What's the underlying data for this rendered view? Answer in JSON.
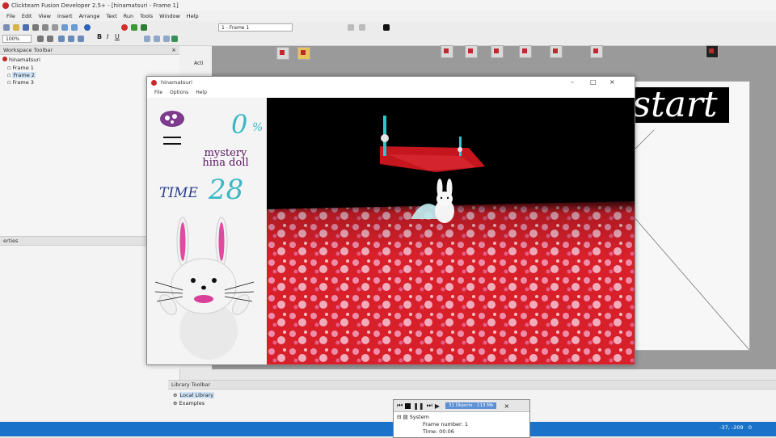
{
  "ide": {
    "title": "Clickteam Fusion Developer 2.5+ - [hinamatsuri - Frame 1]",
    "menu": [
      "File",
      "Edit",
      "View",
      "Insert",
      "Arrange",
      "Text",
      "Run",
      "Tools",
      "Window",
      "Help"
    ],
    "zoom": "100%",
    "frame_selector": "1 - Frame 1",
    "workspace": {
      "header": "Workspace Toolbar",
      "root": "hinamatsuri",
      "frames": [
        "Frame 1",
        "Frame 2",
        "Frame 3"
      ],
      "selected_index": 1
    },
    "properties_header": "erties",
    "editor_tab": "Acti",
    "library": {
      "header": "Library Toolbar",
      "items": [
        "Local Library",
        "Examples"
      ]
    },
    "status_coords": "-37, -209",
    "status_extra": "0",
    "start_text": "start"
  },
  "debugger": {
    "objects_info": "31 Objects - 113 Mb",
    "tree_root": "System",
    "frame_number": "Frame number: 1",
    "time": "Time: 00:06"
  },
  "game": {
    "window_title": "hinamatsuri",
    "menu": [
      "File",
      "Options",
      "Help"
    ],
    "percent_value": "0",
    "percent_sign": "%",
    "doll_name_line1": "mystery",
    "doll_name_line2": "hina doll",
    "time_label": "TIME",
    "time_value": "28"
  },
  "colors": {
    "accent_cyan": "#3bb7c5",
    "doll_text": "#5a1560",
    "time_text": "#283e8c",
    "status_blue": "#1a73c8",
    "carpet_red": "#d8202b"
  }
}
